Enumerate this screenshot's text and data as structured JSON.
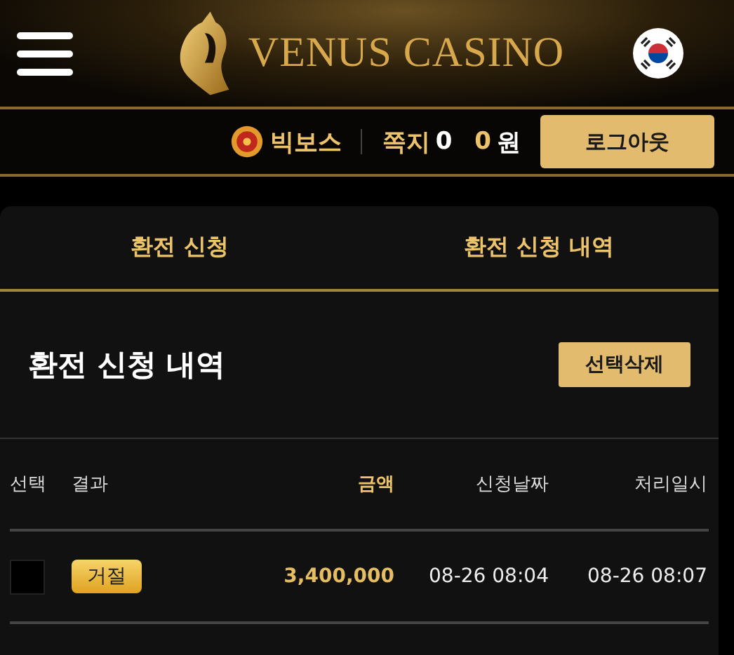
{
  "header": {
    "logo_text": "VENUS CASINO"
  },
  "user_bar": {
    "nickname": "빅보스",
    "messages_label": "쪽지",
    "messages_count": "0",
    "balance": "0",
    "currency": "원",
    "logout_button": "로그아웃"
  },
  "tabs": [
    {
      "label": "환전 신청"
    },
    {
      "label": "환전 신청 내역"
    }
  ],
  "section": {
    "title": "환전 신청 내역",
    "delete_button": "선택삭제"
  },
  "table": {
    "columns": [
      {
        "label": "선택",
        "highlight": false
      },
      {
        "label": "결과",
        "highlight": false
      },
      {
        "label": "금액",
        "highlight": true
      },
      {
        "label": "신청날짜",
        "highlight": false
      },
      {
        "label": "처리일시",
        "highlight": false
      }
    ],
    "rows": [
      {
        "checked": false,
        "result": "거절",
        "amount": "3,400,000",
        "requested": "08-26 08:04",
        "processed": "08-26 08:07"
      }
    ]
  }
}
